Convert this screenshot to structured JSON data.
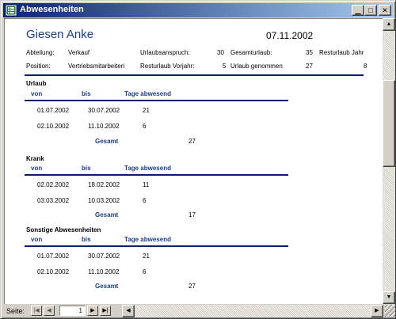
{
  "window": {
    "title": "Abwesenheiten"
  },
  "header": {
    "name": "Giesen Anke",
    "date": "07.11.2002",
    "abteilung_label": "Abteilung:",
    "abteilung_value": "Verkauf",
    "position_label": "Position:",
    "position_value": "Vertriebsmitarbeiteri",
    "urlaubsanspruch_label": "Urlaubsanspruch:",
    "urlaubsanspruch_value": "30",
    "resturlaub_vorjahr_label": "Resturlaub Vorjahr:",
    "resturlaub_vorjahr_value": "5",
    "gesamturlaub_label": "Gesamturlaub:",
    "gesamturlaub_value": "35",
    "urlaub_genommen_label": "Urlaub genommen",
    "urlaub_genommen_value": "27",
    "resturlaub_jahr_label": "Resturlaub Jahr",
    "resturlaub_jahr_value": "8"
  },
  "columns": {
    "von": "von",
    "bis": "bis",
    "tage": "Tage abwesend"
  },
  "gesamt_label": "Gesamt",
  "sections": [
    {
      "title": "Urlaub",
      "rows": [
        {
          "von": "01.07.2002",
          "bis": "30.07.2002",
          "tage": "21"
        },
        {
          "von": "02.10.2002",
          "bis": "11.10.2002",
          "tage": "6"
        }
      ],
      "total": "27"
    },
    {
      "title": "Krank",
      "rows": [
        {
          "von": "02.02.2002",
          "bis": "18.02.2002",
          "tage": "11"
        },
        {
          "von": "03.03.2002",
          "bis": "10.03.2002",
          "tage": "6"
        }
      ],
      "total": "17"
    },
    {
      "title": "Sonstige Abwesenheiten",
      "rows": [
        {
          "von": "01.07.2002",
          "bis": "30.07.2002",
          "tage": "21"
        },
        {
          "von": "02.10.2002",
          "bis": "11.10.2002",
          "tage": "6"
        }
      ],
      "total": "27"
    }
  ],
  "statusbar": {
    "seite_label": "Seite:",
    "page_number": "1"
  },
  "colors": {
    "accent": "#1a3d8c",
    "rule": "#0a1f6a",
    "titlebar": "#0a246a"
  }
}
